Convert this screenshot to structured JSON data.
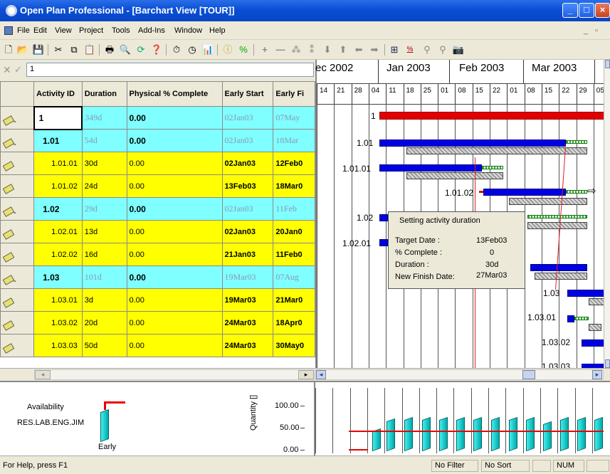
{
  "window": {
    "title": "Open Plan Professional - [Barchart View [TOUR]]"
  },
  "menu": [
    "File",
    "Edit",
    "View",
    "Project",
    "Tools",
    "Add-Ins",
    "Window",
    "Help"
  ],
  "editbar": {
    "value": "1"
  },
  "grid": {
    "columns": [
      "Activity ID",
      "Duration",
      "Physical % Complete",
      "Early Start",
      "Early Fi"
    ],
    "rows": [
      {
        "kind": "sum",
        "id": "1",
        "dur": "349d",
        "pct": "0.00",
        "es": "02Jan03",
        "ef": "07May"
      },
      {
        "kind": "sum",
        "id": "1.01",
        "dur": "54d",
        "pct": "0.00",
        "es": "02Jan03",
        "ef": "18Mar"
      },
      {
        "kind": "det",
        "id": "1.01.01",
        "dur": "30d",
        "pct": "0.00",
        "es": "02Jan03",
        "ef": "12Feb0"
      },
      {
        "kind": "det",
        "id": "1.01.02",
        "dur": "24d",
        "pct": "0.00",
        "es": "13Feb03",
        "ef": "18Mar0"
      },
      {
        "kind": "sum",
        "id": "1.02",
        "dur": "29d",
        "pct": "0.00",
        "es": "02Jan03",
        "ef": "11Feb"
      },
      {
        "kind": "det",
        "id": "1.02.01",
        "dur": "13d",
        "pct": "0.00",
        "es": "02Jan03",
        "ef": "20Jan0"
      },
      {
        "kind": "det",
        "id": "1.02.02",
        "dur": "16d",
        "pct": "0.00",
        "es": "21Jan03",
        "ef": "11Feb0"
      },
      {
        "kind": "sum",
        "id": "1.03",
        "dur": "101d",
        "pct": "0.00",
        "es": "19Mar03",
        "ef": "07Aug"
      },
      {
        "kind": "det",
        "id": "1.03.01",
        "dur": "3d",
        "pct": "0.00",
        "es": "19Mar03",
        "ef": "21Mar0"
      },
      {
        "kind": "det",
        "id": "1.03.02",
        "dur": "20d",
        "pct": "0.00",
        "es": "24Mar03",
        "ef": "18Apr0"
      },
      {
        "kind": "det",
        "id": "1.03.03",
        "dur": "50d",
        "pct": "0.00",
        "es": "24Mar03",
        "ef": "30May0"
      }
    ]
  },
  "timescale": {
    "months": [
      "ec 2002",
      "Jan 2003",
      "Feb 2003",
      "Mar 2003"
    ],
    "weeks": [
      "14",
      "21",
      "28",
      "04",
      "11",
      "18",
      "25",
      "01",
      "08",
      "15",
      "22",
      "01",
      "08",
      "15",
      "22",
      "29",
      "05"
    ]
  },
  "gantt_labels": [
    "1",
    "1.01",
    "1.01.01",
    "1.01.02",
    "1.02",
    "1.02.01",
    "1.03",
    "1.03.01",
    "1.03.02",
    "1.03.03"
  ],
  "tooltip": {
    "title": "Setting activity duration",
    "rows": [
      {
        "k": "Target Date :",
        "v": "13Feb03"
      },
      {
        "k": "% Complete :",
        "v": "0"
      },
      {
        "k": "Duration :",
        "v": "30d"
      },
      {
        "k": "New Finish Date:",
        "v": "27Mar03"
      }
    ]
  },
  "resource": {
    "availability": "Availability",
    "resource_name": "RES.LAB.ENG.JIM",
    "early": "Early",
    "axis_label": "Quantity []",
    "ticks": [
      "100.00",
      "50.00",
      "0.00"
    ]
  },
  "status": {
    "help": "For Help, press F1",
    "filter": "No Filter",
    "sort": "No Sort",
    "num": "NUM"
  },
  "colors": {
    "summary_row": "#7fffff",
    "detail_row": "#ffff00",
    "bar_red": "#e00000",
    "bar_blue": "#0000e0",
    "titlebar": "#0a4fd6"
  }
}
